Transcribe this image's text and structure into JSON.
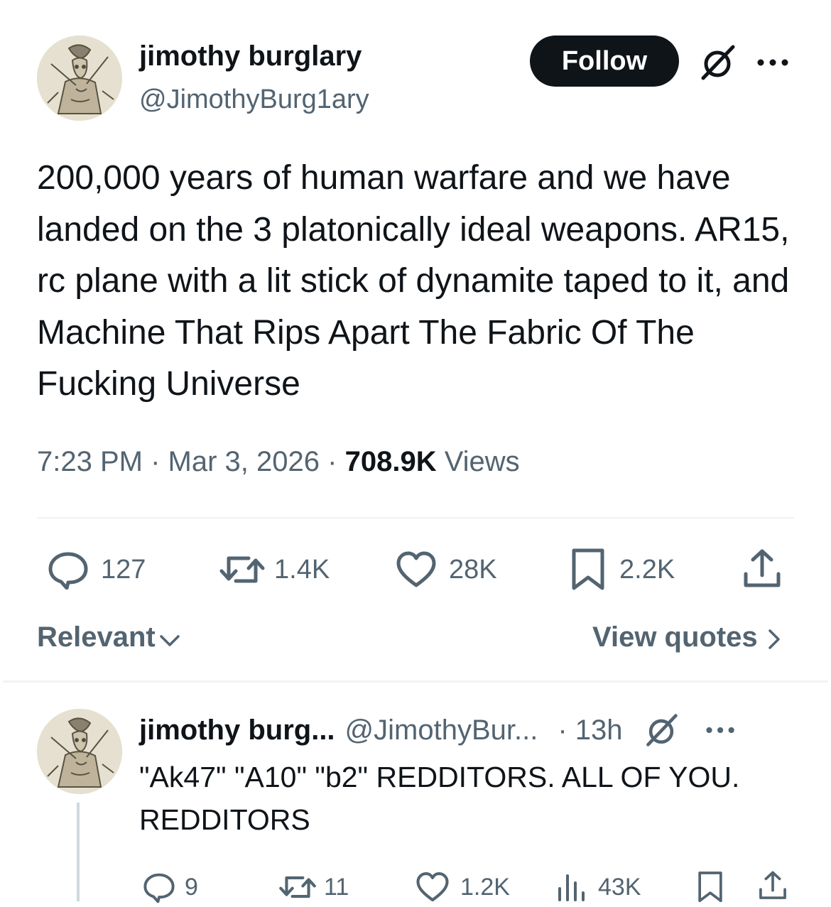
{
  "tweet": {
    "author": {
      "name": "jimothy burglary",
      "handle": "@JimothyBurg1ary",
      "avatar_icon": "engraving-avatar"
    },
    "follow_label": "Follow",
    "text": "200,000 years of human warfare and we have landed on the 3 platonically ideal weapons. AR15, rc plane with a lit stick of dynamite taped to it, and Machine That Rips Apart The Fabric Of The Fucking Universe",
    "time": "7:23 PM",
    "date": "Mar 3, 2026",
    "sep": "·",
    "views_count": "708.9K",
    "views_label": "Views",
    "stats": {
      "replies": "127",
      "reposts": "1.4K",
      "likes": "28K",
      "bookmarks": "2.2K"
    },
    "relevant_label": "Relevant",
    "view_quotes_label": "View quotes"
  },
  "reply": {
    "name": "jimothy burg...",
    "handle": "@JimothyBur...",
    "time": "· 13h",
    "text": "\"Ak47\" \"A10\" \"b2\" REDDITORS. ALL OF YOU. REDDITORS",
    "stats": {
      "replies": "9",
      "reposts": "11",
      "likes": "1.2K",
      "views": "43K"
    }
  },
  "colors": {
    "text_primary": "#0f1419",
    "text_secondary": "#536471",
    "divider": "#eff3f4",
    "button_bg": "#0f1419"
  },
  "icons": [
    "grok-icon",
    "more-icon",
    "reply-icon",
    "repost-icon",
    "like-icon",
    "bookmark-icon",
    "share-icon",
    "views-icon",
    "chevron-down-icon",
    "chevron-right-icon"
  ]
}
